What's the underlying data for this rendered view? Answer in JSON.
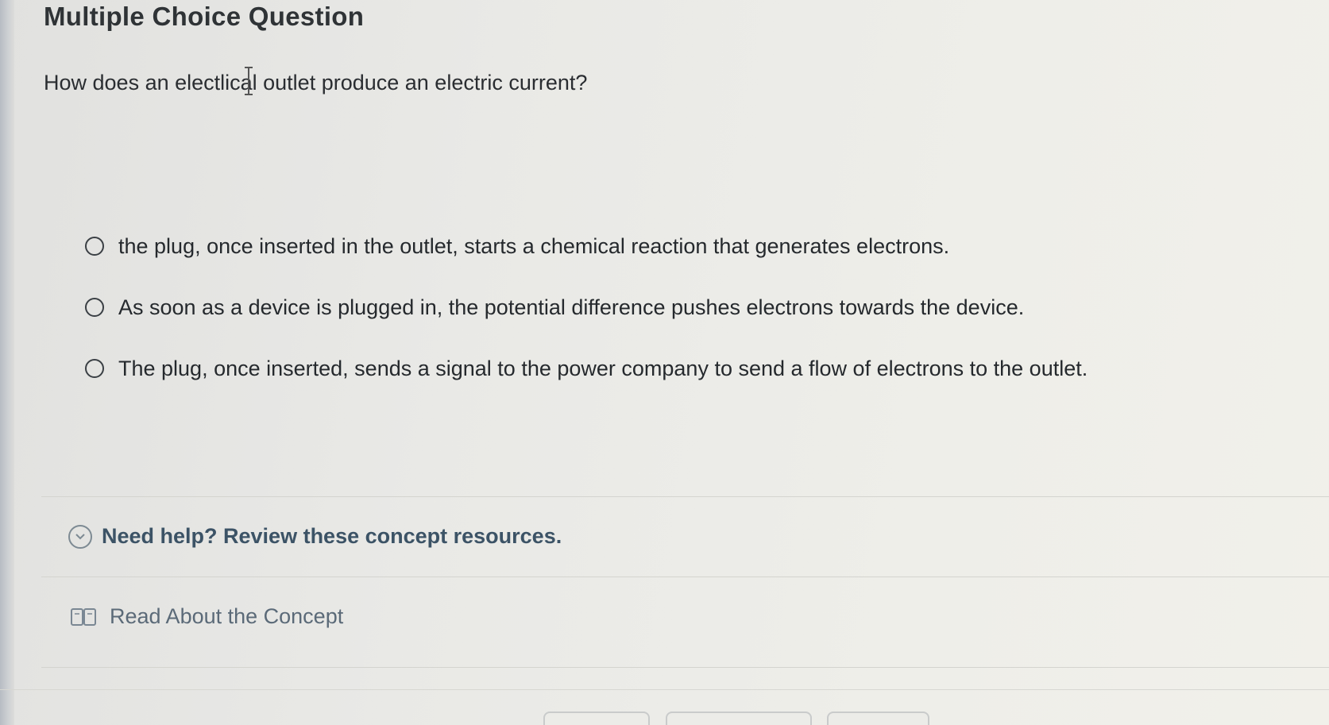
{
  "page": {
    "title": "Multiple Choice Question"
  },
  "question": {
    "text": "How does an electlical outlet produce an electric current?"
  },
  "options": [
    {
      "label": "the plug, once inserted in the outlet, starts a chemical reaction that generates electrons.",
      "selected": false
    },
    {
      "label": "As soon as a device is plugged in, the potential difference pushes electrons towards the device.",
      "selected": false
    },
    {
      "label": "The plug, once inserted, sends a signal to the power company to send a flow of electrons to the outlet.",
      "selected": false
    }
  ],
  "help": {
    "label": "Need help? Review these concept resources.",
    "icon": "chevron-down-circle-icon",
    "expanded": true
  },
  "resources": [
    {
      "label": "Read About the Concept",
      "icon": "book-icon"
    }
  ],
  "colors": {
    "help_text": "#3c5366",
    "resource_text": "#5b6a78",
    "background": "#ecece8"
  }
}
